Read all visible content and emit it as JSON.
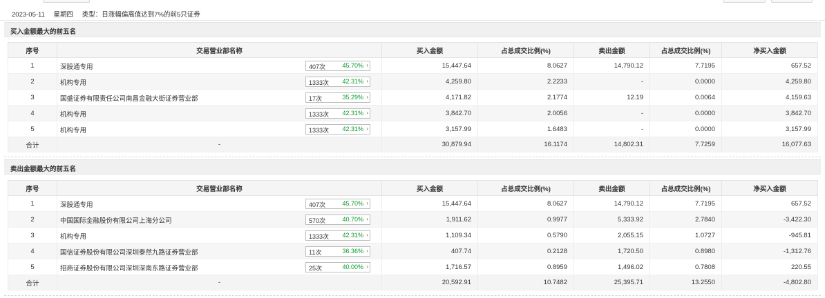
{
  "header": {
    "date": "2023-05-11",
    "weekday": "星期四",
    "type_label": "类型：",
    "type_value": "日涨幅偏离值达到7%的前5只证券"
  },
  "columns": [
    "序号",
    "交易营业部名称",
    "买入金额",
    "占总成交比例(%)",
    "卖出金额",
    "占总成交比例(%)",
    "净买入金额"
  ],
  "buy_section": {
    "title": "买入金额最大的前五名",
    "rows": [
      {
        "idx": "1",
        "name": "深股通专用",
        "count": "407次",
        "rate": "45.70%",
        "buy": "15,447.64",
        "buy_pct": "8.0627",
        "sell": "14,790.12",
        "sell_pct": "7.7195",
        "net": "657.52"
      },
      {
        "idx": "2",
        "name": "机构专用",
        "count": "1333次",
        "rate": "42.31%",
        "buy": "4,259.80",
        "buy_pct": "2.2233",
        "sell": "-",
        "sell_pct": "0.0000",
        "net": "4,259.80"
      },
      {
        "idx": "3",
        "name": "国盛证券有限责任公司南昌金融大街证券营业部",
        "count": "17次",
        "rate": "35.29%",
        "buy": "4,171.82",
        "buy_pct": "2.1774",
        "sell": "12.19",
        "sell_pct": "0.0064",
        "net": "4,159.63"
      },
      {
        "idx": "4",
        "name": "机构专用",
        "count": "1333次",
        "rate": "42.31%",
        "buy": "3,842.70",
        "buy_pct": "2.0056",
        "sell": "-",
        "sell_pct": "0.0000",
        "net": "3,842.70"
      },
      {
        "idx": "5",
        "name": "机构专用",
        "count": "1333次",
        "rate": "42.31%",
        "buy": "3,157.99",
        "buy_pct": "1.6483",
        "sell": "-",
        "sell_pct": "0.0000",
        "net": "3,157.99"
      }
    ],
    "total": {
      "label": "合计",
      "name": "-",
      "buy": "30,879.94",
      "buy_pct": "16.1174",
      "sell": "14,802.31",
      "sell_pct": "7.7259",
      "net": "16,077.63"
    }
  },
  "sell_section": {
    "title": "卖出金额最大的前五名",
    "rows": [
      {
        "idx": "1",
        "name": "深股通专用",
        "count": "407次",
        "rate": "45.70%",
        "buy": "15,447.64",
        "buy_pct": "8.0627",
        "sell": "14,790.12",
        "sell_pct": "7.7195",
        "net": "657.52"
      },
      {
        "idx": "2",
        "name": "中国国际金融股份有限公司上海分公司",
        "count": "570次",
        "rate": "40.70%",
        "buy": "1,911.62",
        "buy_pct": "0.9977",
        "sell": "5,333.92",
        "sell_pct": "2.7840",
        "net": "-3,422.30"
      },
      {
        "idx": "3",
        "name": "机构专用",
        "count": "1333次",
        "rate": "42.31%",
        "buy": "1,109.34",
        "buy_pct": "0.5790",
        "sell": "2,055.15",
        "sell_pct": "1.0727",
        "net": "-945.81"
      },
      {
        "idx": "4",
        "name": "国信证券股份有限公司深圳泰然九路证券营业部",
        "count": "11次",
        "rate": "36.36%",
        "buy": "407.74",
        "buy_pct": "0.2128",
        "sell": "1,720.50",
        "sell_pct": "0.8980",
        "net": "-1,312.76"
      },
      {
        "idx": "5",
        "name": "招商证券股份有限公司深圳深南东路证券营业部",
        "count": "25次",
        "rate": "40.00%",
        "buy": "1,716.57",
        "buy_pct": "0.8959",
        "sell": "1,496.02",
        "sell_pct": "0.7808",
        "net": "220.55"
      }
    ],
    "total": {
      "label": "合计",
      "name": "-",
      "buy": "20,592.91",
      "buy_pct": "10.7482",
      "sell": "25,395.71",
      "sell_pct": "13.2550",
      "net": "-4,802.80"
    }
  },
  "colors": {
    "buy": "#e8121d",
    "sell": "#0a9a2e",
    "negative": "#0a9a2e",
    "positive": "#e8121d",
    "rate": "#0a9a2e"
  },
  "icons": {
    "badge_arrow": "chevron-right-icon"
  }
}
